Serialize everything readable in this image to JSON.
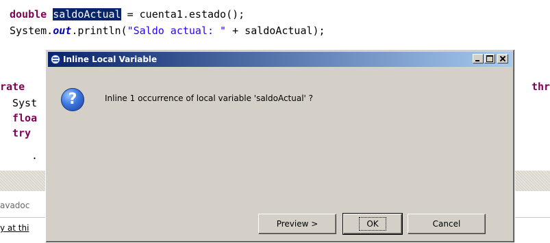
{
  "editor": {
    "line1": {
      "kw": "double",
      "selected_var": "saldoActual",
      "rest": " = cuenta1.estado();"
    },
    "line2": {
      "prefix": "System.",
      "field": "out",
      "mid": ".println(",
      "string": "\"Saldo actual: \"",
      "suffix": " + saldoActual);"
    },
    "frag_rate": "rate",
    "frag_syst": "Syst",
    "frag_floa": "floa",
    "frag_try": "try",
    "frag_thr": "thr",
    "frag_dot": "."
  },
  "bottom_pane": {
    "tab_text": "avadoc",
    "text2": "y at thi"
  },
  "dialog": {
    "title": "Inline Local Variable",
    "message": "Inline 1 occurrence of local variable 'saldoActual' ?",
    "icon": "question-icon",
    "buttons": {
      "preview": "Preview >",
      "ok": "OK",
      "cancel": "Cancel"
    }
  }
}
